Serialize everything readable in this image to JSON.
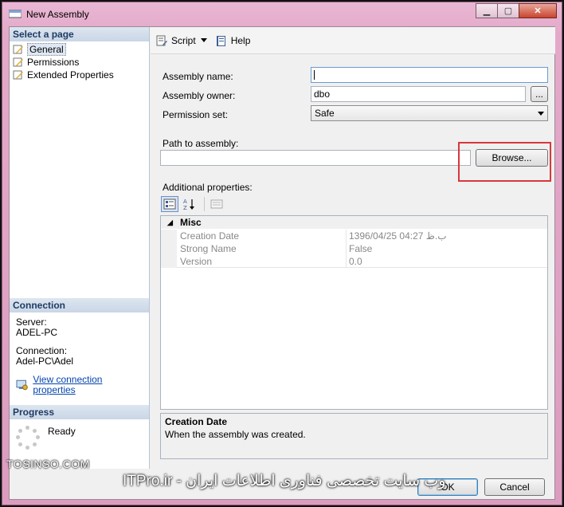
{
  "window": {
    "title": "New Assembly",
    "controls": [
      "minimize",
      "maximize",
      "close"
    ]
  },
  "left_pane": {
    "pages_header": "Select a page",
    "pages": [
      "General",
      "Permissions",
      "Extended Properties"
    ],
    "selected_page": "General",
    "connection_header": "Connection",
    "server_label": "Server:",
    "server_value": "ADEL-PC",
    "connection_label": "Connection:",
    "connection_value": "Adel-PC\\Adel",
    "view_connection_link": "View connection properties",
    "progress_header": "Progress",
    "progress_status": "Ready"
  },
  "toolbar": {
    "script_label": "Script",
    "help_label": "Help"
  },
  "form": {
    "assembly_name_label": "Assembly name:",
    "assembly_name_value": "",
    "assembly_owner_label": "Assembly owner:",
    "assembly_owner_value": "dbo",
    "owner_browse_label": "...",
    "permission_set_label": "Permission set:",
    "permission_set_value": "Safe",
    "path_label": "Path to assembly:",
    "path_value": "",
    "browse_label": "Browse...",
    "additional_props_label": "Additional properties:"
  },
  "property_grid": {
    "category": "Misc",
    "rows": [
      {
        "name": "Creation Date",
        "value": "1396/04/25 04:27 ب.ظ"
      },
      {
        "name": "Strong Name",
        "value": "False"
      },
      {
        "name": "Version",
        "value": "0.0"
      }
    ]
  },
  "description": {
    "title": "Creation Date",
    "text": "When the assembly was created."
  },
  "buttons": {
    "ok": "OK",
    "cancel": "Cancel"
  },
  "watermarks": {
    "left": "TOSINSO.COM",
    "main": "ITPro.ir - وب سایت تخصصی فناوری اطلاعات ایران"
  },
  "colors": {
    "highlight": "#d9373b",
    "section_header_text": "#1e3c64",
    "link": "#0645ad"
  }
}
